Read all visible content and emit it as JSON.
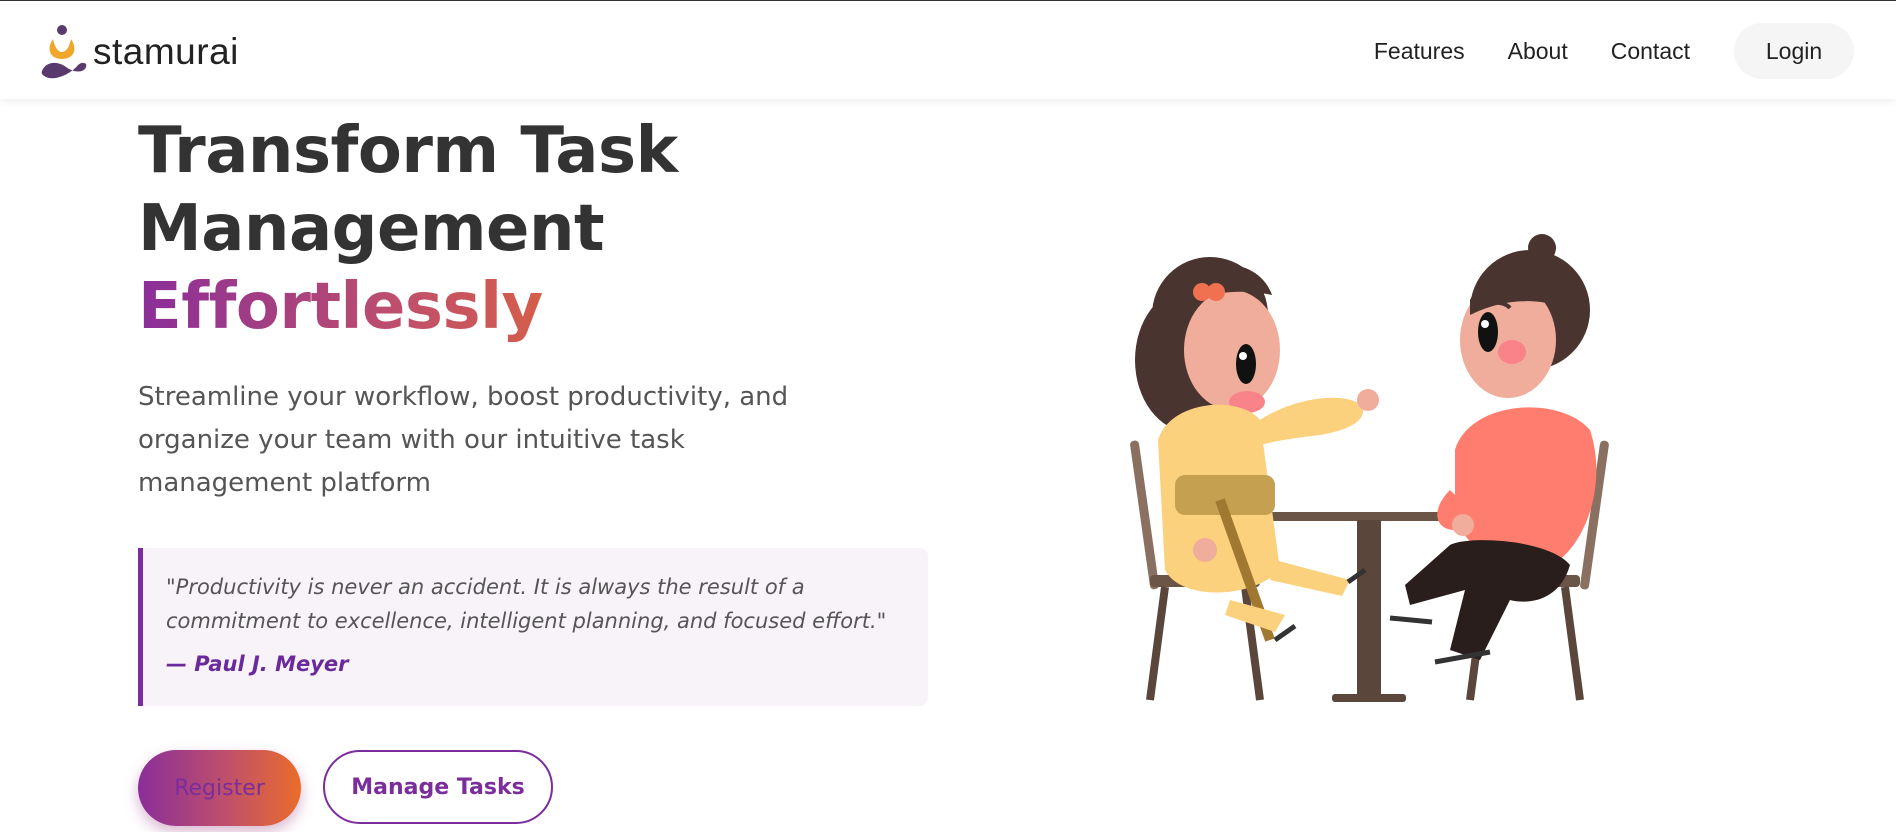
{
  "header": {
    "logo_text": "stamurai",
    "nav": [
      "Features",
      "About",
      "Contact"
    ],
    "login_label": "Login"
  },
  "hero": {
    "title_line1": "Transform Task",
    "title_line2": "Management",
    "title_highlight": "Effortlessly",
    "subtitle": "Streamline your workflow, boost productivity, and organize your team with our intuitive task management platform"
  },
  "quote": {
    "text": "\"Productivity is never an accident. It is always the result of a commitment to excellence, intelligent planning, and focused effort.\"",
    "author": "— Paul J. Meyer"
  },
  "actions": {
    "register_label": "Register",
    "manage_label": "Manage Tasks"
  },
  "colors": {
    "accent_purple": "#7b2d9b",
    "gradient_start": "#8a2e9a",
    "gradient_end": "#ea6c2a"
  }
}
